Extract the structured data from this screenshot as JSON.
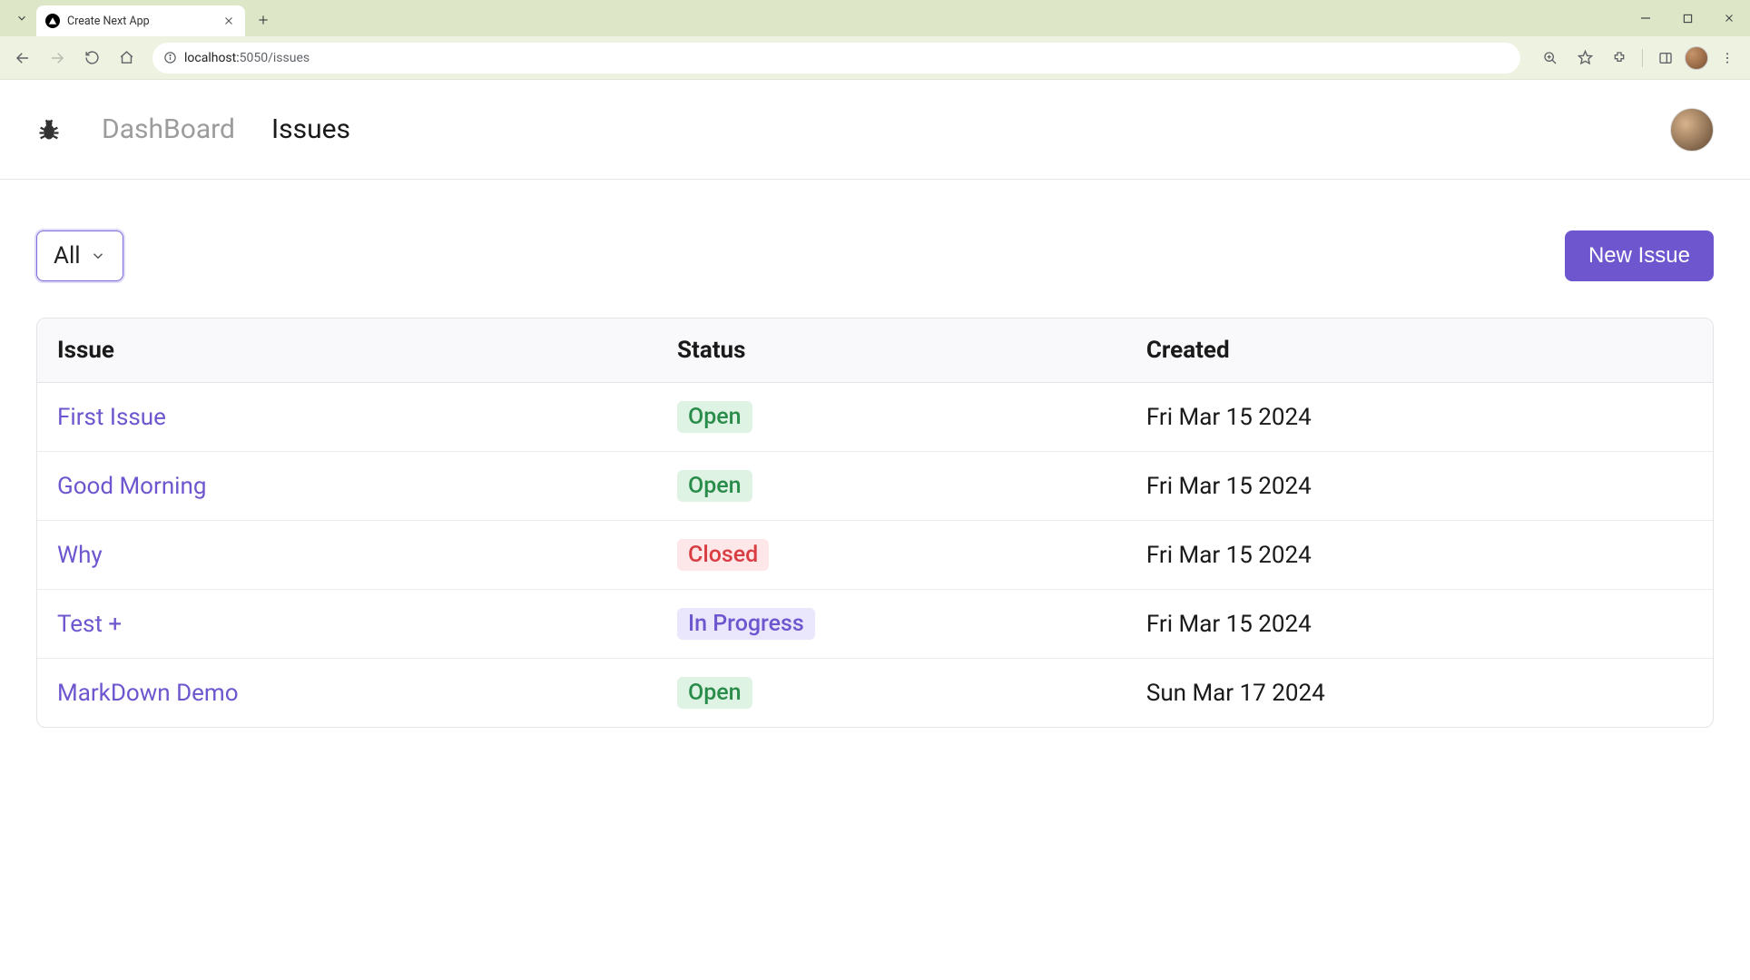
{
  "browser": {
    "tab_title": "Create Next App",
    "url_host": "localhost:",
    "url_port": "5050",
    "url_path": "/issues"
  },
  "header": {
    "nav": {
      "dashboard": "DashBoard",
      "issues": "Issues"
    }
  },
  "controls": {
    "filter_label": "All",
    "new_issue_label": "New Issue"
  },
  "table": {
    "columns": {
      "issue": "Issue",
      "status": "Status",
      "created": "Created"
    },
    "status_labels": {
      "open": "Open",
      "closed": "Closed",
      "in_progress": "In Progress"
    },
    "rows": [
      {
        "title": "First Issue",
        "status": "open",
        "created": "Fri Mar 15 2024"
      },
      {
        "title": "Good Morning",
        "status": "open",
        "created": "Fri Mar 15 2024"
      },
      {
        "title": "Why",
        "status": "closed",
        "created": "Fri Mar 15 2024"
      },
      {
        "title": "Test +",
        "status": "in_progress",
        "created": "Fri Mar 15 2024"
      },
      {
        "title": "MarkDown Demo",
        "status": "open",
        "created": "Sun Mar 17 2024"
      }
    ]
  }
}
